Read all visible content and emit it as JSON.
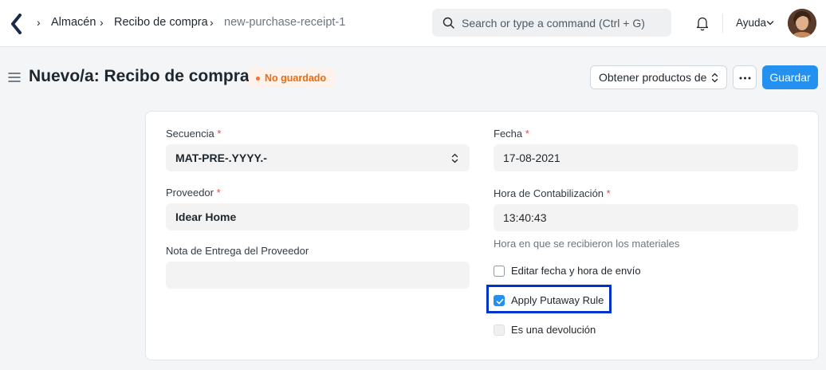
{
  "navbar": {
    "breadcrumbs": [
      "Almacén",
      "Recibo de compra",
      "new-purchase-receipt-1"
    ],
    "search_placeholder": "Search or type a command (Ctrl + G)",
    "help_label": "Ayuda"
  },
  "page": {
    "title": "Nuevo/a: Recibo de compra",
    "status_badge": "No guardado",
    "get_items_button": "Obtener productos de",
    "more_button": "…",
    "save_button": "Guardar"
  },
  "form": {
    "left": {
      "naming_series": {
        "label": "Secuencia",
        "required": "*",
        "value": "MAT-PRE-.YYYY.-"
      },
      "supplier": {
        "label": "Proveedor",
        "required": "*",
        "value": "Idear Home"
      },
      "supplier_delivery_note": {
        "label": "Nota de Entrega del Proveedor",
        "value": ""
      }
    },
    "right": {
      "posting_date": {
        "label": "Fecha",
        "required": "*",
        "value": "17-08-2021"
      },
      "posting_time": {
        "label": "Hora de Contabilización",
        "required": "*",
        "value": "13:40:43",
        "help": "Hora en que se recibieron los materiales"
      },
      "set_posting_time": {
        "label": "Editar fecha y hora de envío",
        "checked": false
      },
      "apply_putaway_rule": {
        "label": "Apply Putaway Rule",
        "checked": true
      },
      "is_return": {
        "label": "Es una devolución",
        "checked": false
      }
    }
  },
  "colors": {
    "primary": "#2490ef",
    "badge_text": "#e86c13",
    "badge_bg": "#fff2ea",
    "required": "#e24c4c",
    "highlight_border": "#0033cc"
  }
}
